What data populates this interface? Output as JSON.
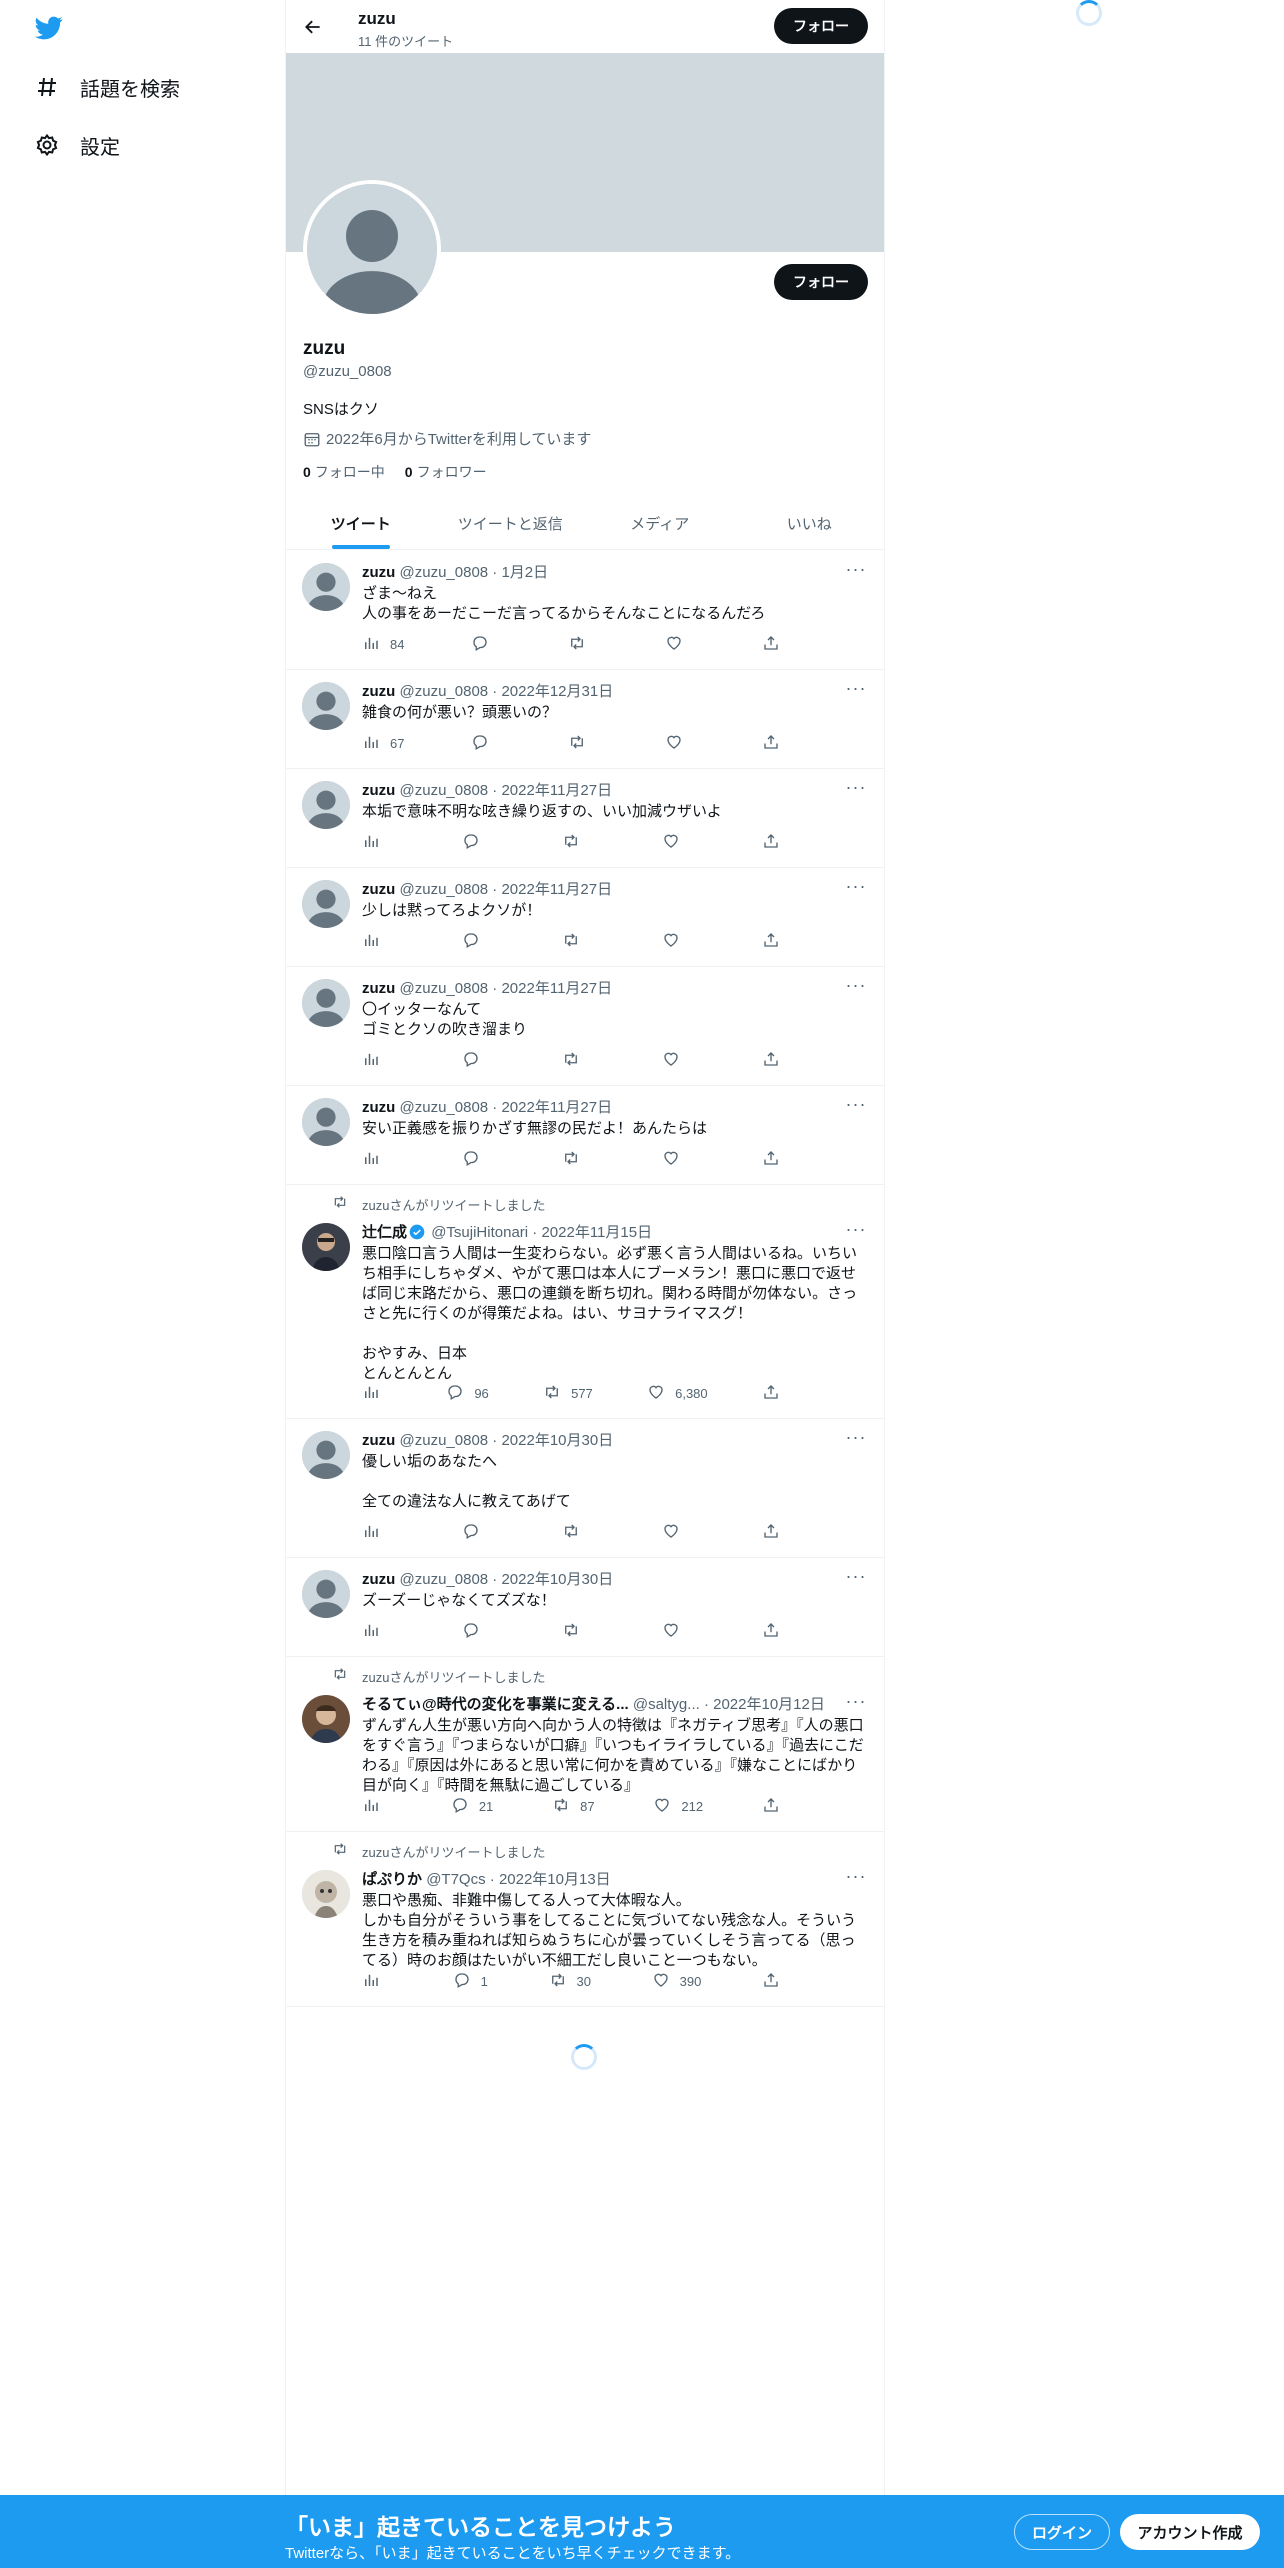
{
  "nav": {
    "logo": "twitter-bird-icon",
    "items": [
      {
        "icon": "hashtag-icon",
        "label": "話題を検索"
      },
      {
        "icon": "gear-icon",
        "label": "設定"
      }
    ]
  },
  "header": {
    "name": "zuzu",
    "tweet_count": "11 件のツイート",
    "follow_label": "フォロー"
  },
  "profile": {
    "name": "zuzu",
    "handle": "@zuzu_0808",
    "bio": "SNSはクソ",
    "joined": "2022年6月からTwitterを利用しています",
    "following_count": "0",
    "following_label": "フォロー中",
    "followers_count": "0",
    "followers_label": "フォロワー",
    "follow_label": "フォロー"
  },
  "tabs": [
    "ツイート",
    "ツイートと返信",
    "メディア",
    "いいね"
  ],
  "tweets": [
    {
      "name": "zuzu",
      "handle": "@zuzu_0808",
      "date": "1月2日",
      "text": "ざま〜ねえ\n人の事をあーだこーだ言ってるからそんなことになるんだろ",
      "views": "84",
      "replies": "",
      "retweets": "",
      "likes": ""
    },
    {
      "name": "zuzu",
      "handle": "@zuzu_0808",
      "date": "2022年12月31日",
      "text": "雑食の何が悪い？頭悪いの？",
      "views": "67",
      "replies": "",
      "retweets": "",
      "likes": ""
    },
    {
      "name": "zuzu",
      "handle": "@zuzu_0808",
      "date": "2022年11月27日",
      "text": "本垢で意味不明な呟き繰り返すの、いい加減ウザいよ",
      "views": "",
      "replies": "",
      "retweets": "",
      "likes": ""
    },
    {
      "name": "zuzu",
      "handle": "@zuzu_0808",
      "date": "2022年11月27日",
      "text": "少しは黙ってろよクソが！",
      "views": "",
      "replies": "",
      "retweets": "",
      "likes": ""
    },
    {
      "name": "zuzu",
      "handle": "@zuzu_0808",
      "date": "2022年11月27日",
      "text": "〇イッターなんて\nゴミとクソの吹き溜まり",
      "views": "",
      "replies": "",
      "retweets": "",
      "likes": ""
    },
    {
      "name": "zuzu",
      "handle": "@zuzu_0808",
      "date": "2022年11月27日",
      "text": "安い正義感を振りかざす無謬の民だよ！あんたらは",
      "views": "",
      "replies": "",
      "retweets": "",
      "likes": ""
    },
    {
      "retweeted_by": "zuzuさんがリツイートしました",
      "name": "辻仁成",
      "verified": true,
      "handle": "@TsujiHitonari",
      "date": "2022年11月15日",
      "text": "悪口陰口言う人間は一生変わらない。必ず悪く言う人間はいるね。いちいち相手にしちゃダメ、やがて悪口は本人にブーメラン！悪口に悪口で返せば同じ末路だから、悪口の連鎖を断ち切れ。関わる時間が勿体ない。さっさと先に行くのが得策だよね。はい、サヨナライマスグ！\n\nおやすみ、日本\nとんとんとん",
      "views": "",
      "replies": "96",
      "retweets": "577",
      "likes": "6,380"
    },
    {
      "name": "zuzu",
      "handle": "@zuzu_0808",
      "date": "2022年10月30日",
      "text": "優しい垢のあなたへ\n\n全ての違法な人に教えてあげて",
      "views": "",
      "replies": "",
      "retweets": "",
      "likes": ""
    },
    {
      "name": "zuzu",
      "handle": "@zuzu_0808",
      "date": "2022年10月30日",
      "text": "ズーズーじゃなくてズズな！",
      "views": "",
      "replies": "",
      "retweets": "",
      "likes": ""
    },
    {
      "retweeted_by": "zuzuさんがリツイートしました",
      "name": "そるてぃ@時代の変化を事業に変える...",
      "handle": "@saltyg...",
      "date": "2022年10月12日",
      "text": "ずんずん人生が悪い方向へ向かう人の特徴は『ネガティブ思考』『人の悪口をすぐ言う』『つまらないが口癖』『いつもイライラしている』『過去にこだわる』『原因は外にあると思い常に何かを責めている』『嫌なことにばかり目が向く』『時間を無駄に過ごしている』",
      "views": "",
      "replies": "21",
      "retweets": "87",
      "likes": "212"
    },
    {
      "retweeted_by": "zuzuさんがリツイートしました",
      "name": "ぱぷりか",
      "handle": "@T7Qcs",
      "date": "2022年10月13日",
      "text": "悪口や愚痴、非難中傷してる人って大体暇な人。\nしかも自分がそういう事をしてることに気づいてない残念な人。そういう生き方を積み重ねれば知らぬうちに心が曇っていくしそう言ってる（思ってる）時のお顔はたいがい不細工だし良いこと一つもない。",
      "views": "",
      "replies": "1",
      "retweets": "30",
      "likes": "390"
    }
  ],
  "bottom_bar": {
    "title": "「いま」起きていることを見つけよう",
    "subtitle": "Twitterなら、「いま」起きていることをいち早くチェックできます。",
    "login_label": "ログイン",
    "signup_label": "アカウント作成"
  },
  "colors": {
    "accent": "#1d9bf0",
    "banner": "#cfd9de",
    "text": "#0f1419",
    "muted": "#536471"
  }
}
